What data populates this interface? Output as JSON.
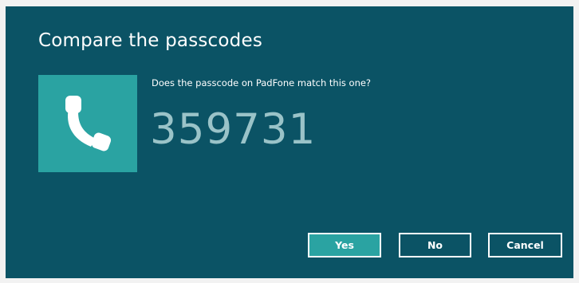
{
  "dialog": {
    "title": "Compare the passcodes",
    "question": "Does the passcode on PadFone match this one?",
    "passcode": "359731",
    "device_icon": "phone-handset-icon",
    "colors": {
      "background": "#0b5365",
      "tile": "#2aa3a2",
      "passcode_text": "#9ac3c8",
      "primary_button": "#2aa3a2"
    }
  },
  "buttons": {
    "yes_label": "Yes",
    "no_label": "No",
    "cancel_label": "Cancel"
  }
}
